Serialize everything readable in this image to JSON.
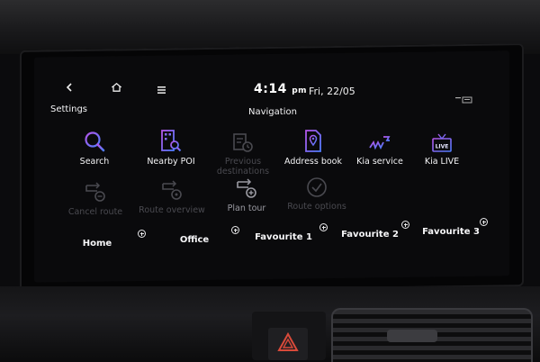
{
  "header": {
    "back_icon": "chevron-left-icon",
    "home_icon": "home-icon",
    "menu_icon": "menu-icon",
    "time": "4:14",
    "ampm": "pm",
    "date": "Fri, 22/05",
    "status_icon": "connectivity-icon"
  },
  "sections": {
    "settings": "Settings",
    "navigation": "Navigation"
  },
  "row1": [
    {
      "label": "Search",
      "icon": "search-icon",
      "enabled": true
    },
    {
      "label": "Nearby POI",
      "icon": "nearby-poi-icon",
      "enabled": true
    },
    {
      "label": "Previous destinations",
      "icon": "previous-destinations-icon",
      "enabled": false
    },
    {
      "label": "Address book",
      "icon": "address-book-icon",
      "enabled": true
    },
    {
      "label": "Kia service",
      "icon": "kia-service-icon",
      "enabled": true
    },
    {
      "label": "Kia LIVE",
      "icon": "kia-live-icon",
      "enabled": true
    }
  ],
  "row2": [
    {
      "label": "Cancel route",
      "icon": "cancel-route-icon",
      "enabled": false
    },
    {
      "label": "Route overview",
      "icon": "route-overview-icon",
      "enabled": false
    },
    {
      "label": "Plan tour",
      "icon": "plan-tour-icon",
      "enabled": true
    },
    {
      "label": "Route options",
      "icon": "route-options-icon",
      "enabled": false
    }
  ],
  "favourites": [
    {
      "label": "Home"
    },
    {
      "label": "Office"
    },
    {
      "label": "Favourite 1"
    },
    {
      "label": "Favourite 2"
    },
    {
      "label": "Favourite 3"
    }
  ],
  "colors": {
    "accent_blue": "#4f7dff",
    "accent_purple": "#b455e8",
    "disabled": "#4a4a50"
  },
  "kia_live_badge": "LIVE"
}
